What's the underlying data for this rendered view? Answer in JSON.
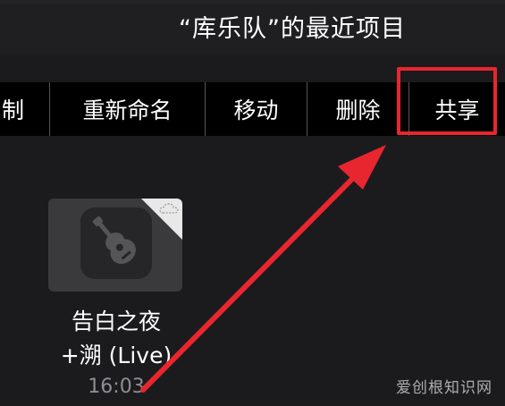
{
  "header": {
    "title": "“库乐队”的最近项目"
  },
  "menu": {
    "items": [
      {
        "label": "制"
      },
      {
        "label": "重新命名"
      },
      {
        "label": "移动"
      },
      {
        "label": "删除"
      },
      {
        "label": "共享"
      }
    ]
  },
  "file": {
    "name_line1": "告白之夜",
    "name_line2": "+溯 (Live)",
    "time": "16:03",
    "icon": "garageband-guitar-icon"
  },
  "watermark": "爱创根知识网",
  "colors": {
    "accent_red": "#e8262f",
    "menu_bg": "#000000",
    "background": "#1b1b1d"
  }
}
